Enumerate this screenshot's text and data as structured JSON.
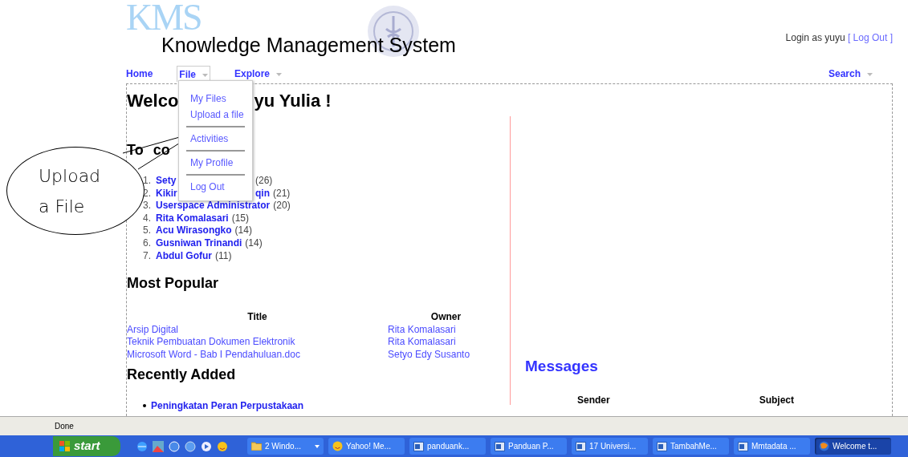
{
  "header": {
    "logo_letters": "KMS",
    "logo_title": "Knowledge Management System",
    "login_text": "Login as yuyu",
    "logout_link": "[ Log Out ]"
  },
  "nav": [
    {
      "label": "Home",
      "dropdown": false,
      "open": false
    },
    {
      "label": "File",
      "dropdown": true,
      "open": true
    },
    {
      "label": "Explore",
      "dropdown": true,
      "open": false
    }
  ],
  "search_menu": {
    "label": "Search",
    "dropdown": true
  },
  "file_menu": [
    [
      "My Files",
      "Upload a file"
    ],
    [
      "Activities"
    ],
    [
      "My Profile"
    ],
    [
      "Log Out"
    ]
  ],
  "welcome_parts": [
    "Welco",
    "yu Yulia !"
  ],
  "top_contributors": {
    "heading_parts": [
      "To",
      "co"
    ],
    "items": [
      {
        "number": "1.",
        "name_parts": [
          "Sety"
        ],
        "count": "(26)"
      },
      {
        "number": "2.",
        "name_parts": [
          "Kikir",
          "qin"
        ],
        "count": "(21)"
      },
      {
        "number": "3.",
        "name_parts": [
          "Userspace Administrator"
        ],
        "count": "(20)"
      },
      {
        "number": "4.",
        "name_parts": [
          "Rita Komalasari"
        ],
        "count": "(15)"
      },
      {
        "number": "5.",
        "name_parts": [
          "Acu Wirasongko"
        ],
        "count": "(14)"
      },
      {
        "number": "6.",
        "name_parts": [
          "Gusniwan Trinandi"
        ],
        "count": "(14)"
      },
      {
        "number": "7.",
        "name_parts": [
          "Abdul Gofur"
        ],
        "count": "(11)"
      }
    ]
  },
  "most_popular": {
    "heading": "Most Popular",
    "columns": [
      "Title",
      "Owner"
    ],
    "rows": [
      [
        "Arsip Digital",
        "Rita Komalasari"
      ],
      [
        "Teknik Pembuatan Dokumen Elektronik",
        "Rita Komalasari"
      ],
      [
        "Microsoft Word - Bab I Pendahuluan.doc",
        "Setyo Edy Susanto"
      ]
    ]
  },
  "recently_added": {
    "heading": "Recently Added",
    "items": [
      "Peningkatan Peran Perpustakaan"
    ]
  },
  "messages": {
    "heading": "Messages",
    "columns": [
      "Sender",
      "Subject"
    ]
  },
  "callout": {
    "text": "Upload a File"
  },
  "status_bar": {
    "text": "Done"
  },
  "taskbar": {
    "start": "start",
    "items": [
      {
        "label": "2 Windo...",
        "kind": "folder",
        "selected": false,
        "dropdown": true
      },
      {
        "label": "Yahoo! Me...",
        "kind": "smiley",
        "selected": false,
        "dropdown": false
      },
      {
        "label": "panduank...",
        "kind": "document",
        "selected": false,
        "dropdown": false
      },
      {
        "label": "Panduan P...",
        "kind": "document",
        "selected": false,
        "dropdown": false
      },
      {
        "label": "17 Universi...",
        "kind": "document",
        "selected": false,
        "dropdown": false
      },
      {
        "label": "TambahMe...",
        "kind": "document",
        "selected": false,
        "dropdown": false
      },
      {
        "label": "Mmtadata ...",
        "kind": "document",
        "selected": false,
        "dropdown": false
      },
      {
        "label": "Welcome t...",
        "kind": "browser",
        "selected": true,
        "dropdown": false
      }
    ]
  }
}
